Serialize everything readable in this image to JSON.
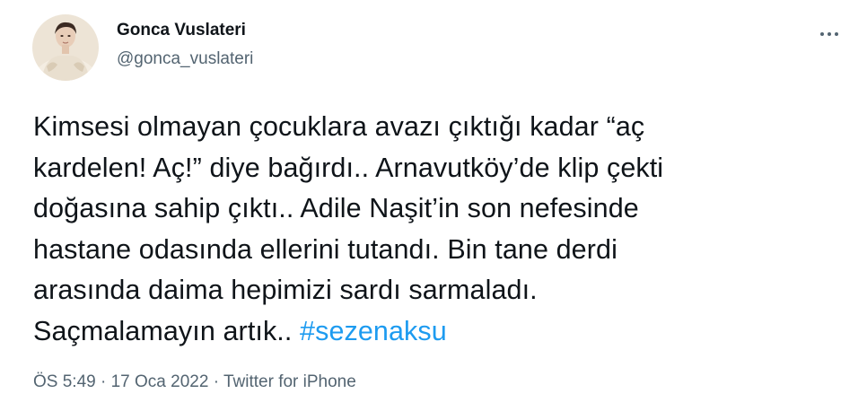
{
  "author": {
    "display_name": "Gonca Vuslateri",
    "handle": "@gonca_vuslateri"
  },
  "more_icon": "more-horizontal-icon",
  "tweet": {
    "lines": [
      "Kimsesi olmayan çocuklara avazı çıktığı kadar “aç",
      "kardelen! Aç!” diye bağırdı.. Arnavutköy’de klip çekti",
      "doğasına sahip çıktı.. Adile Naşit’in son nefesinde",
      "hastane odasında ellerini tutandı. Bin tane derdi",
      "arasında daima hepimizi sardı sarmaladı."
    ],
    "last_line_text": "Saçmalamayın artık.. ",
    "hashtag": "#sezenaksu"
  },
  "meta": {
    "time": "ÖS 5:49",
    "separator": " · ",
    "date": "17 Oca 2022",
    "source": "Twitter for iPhone"
  },
  "colors": {
    "text": "#0f1419",
    "secondary": "#536471",
    "link": "#1d9bf0"
  }
}
